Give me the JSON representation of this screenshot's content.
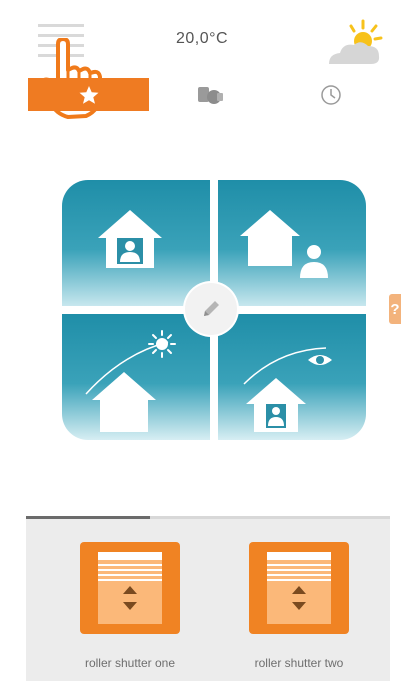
{
  "header": {
    "temperature": "20,0°C",
    "menu_icon": "hamburger-menu-icon",
    "weather_icon": "sun-cloud-icon"
  },
  "tabs": [
    {
      "name": "favorites",
      "icon": "star-icon",
      "active": true
    },
    {
      "name": "scenes",
      "icon": "scene-devices-icon",
      "active": false
    },
    {
      "name": "timer",
      "icon": "clock-icon",
      "active": false
    }
  ],
  "scenes": [
    {
      "position": "top-left",
      "icon": "home-person-inside-icon"
    },
    {
      "position": "top-right",
      "icon": "home-person-away-icon"
    },
    {
      "position": "bottom-left",
      "icon": "home-sun-icon"
    },
    {
      "position": "bottom-right",
      "icon": "home-eye-icon"
    }
  ],
  "help": {
    "label": "?"
  },
  "devices": [
    {
      "label": "roller shutter one",
      "icon": "roller-shutter-icon"
    },
    {
      "label": "roller shutter two",
      "icon": "roller-shutter-icon"
    }
  ],
  "colors": {
    "accent": "#ef7b22",
    "tile": "#1f8ea8",
    "panel": "#ececec"
  }
}
